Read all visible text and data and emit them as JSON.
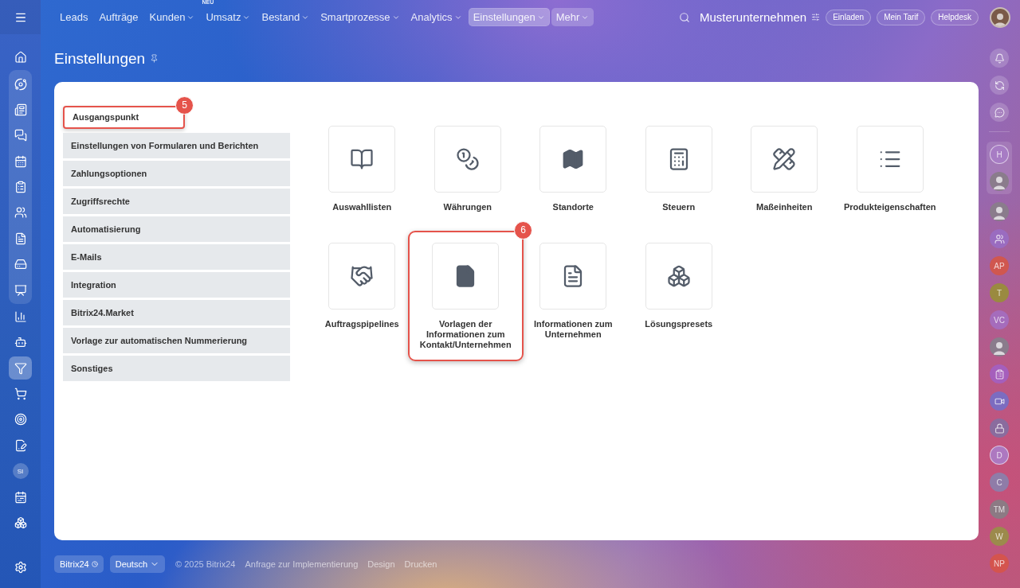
{
  "nav": {
    "items": [
      {
        "label": "Leads",
        "dropdown": false,
        "selected": false,
        "kind": "link"
      },
      {
        "label": "Aufträge",
        "dropdown": false,
        "selected": false,
        "kind": "link"
      },
      {
        "label": "Kunden",
        "dropdown": true,
        "selected": false,
        "kind": "link"
      },
      {
        "label": "Umsatz",
        "dropdown": true,
        "selected": false,
        "kind": "link",
        "badge": "NEU"
      },
      {
        "label": "Bestand",
        "dropdown": true,
        "selected": false,
        "kind": "link"
      },
      {
        "label": "Smartprozesse",
        "dropdown": true,
        "selected": false,
        "kind": "link"
      },
      {
        "label": "Analytics",
        "dropdown": true,
        "selected": false,
        "kind": "link"
      },
      {
        "label": "Einstellungen",
        "dropdown": true,
        "selected": true,
        "kind": "link"
      },
      {
        "label": "Mehr",
        "dropdown": true,
        "selected": false,
        "kind": "more"
      }
    ]
  },
  "header": {
    "company": "Musterunternehmen",
    "buttons": [
      "Einladen",
      "Mein Tarif",
      "Helpdesk"
    ]
  },
  "left_bar": {
    "top": [
      {
        "kind": "home",
        "selected": false
      }
    ],
    "group": [
      {
        "kind": "activity",
        "selected": false
      },
      {
        "kind": "news",
        "selected": false
      },
      {
        "kind": "chat",
        "selected": false
      },
      {
        "kind": "calendar",
        "selected": false
      },
      {
        "kind": "tasks",
        "selected": false
      },
      {
        "kind": "contacts",
        "selected": false
      },
      {
        "kind": "document",
        "selected": false
      },
      {
        "kind": "drive",
        "selected": false
      },
      {
        "kind": "presentation",
        "selected": false
      }
    ],
    "rest": [
      {
        "kind": "chart",
        "selected": false
      },
      {
        "kind": "bot",
        "selected": false
      },
      {
        "kind": "funnel",
        "selected": true
      },
      {
        "kind": "cart",
        "selected": false
      },
      {
        "kind": "target",
        "selected": false
      },
      {
        "kind": "sign",
        "selected": false
      },
      {
        "kind": "initials",
        "label": "SI",
        "selected": false
      },
      {
        "kind": "schedule",
        "selected": false
      },
      {
        "kind": "widget",
        "selected": false
      }
    ]
  },
  "page_title": "Einstellungen",
  "settings_menu": [
    {
      "label": "Ausgangspunkt",
      "selected": true,
      "step": "5"
    },
    {
      "label": "Einstellungen von Formularen und Berichten",
      "selected": false
    },
    {
      "label": "Zahlungsoptionen",
      "selected": false
    },
    {
      "label": "Zugriffsrechte",
      "selected": false
    },
    {
      "label": "Automatisierung",
      "selected": false
    },
    {
      "label": "E-Mails",
      "selected": false
    },
    {
      "label": "Integration",
      "selected": false
    },
    {
      "label": "Bitrix24.Market",
      "selected": false
    },
    {
      "label": "Vorlage zur automatischen Nummerierung",
      "selected": false
    },
    {
      "label": "Sonstiges",
      "selected": false
    }
  ],
  "tiles": [
    {
      "label": "Auswahllisten",
      "kind": "book"
    },
    {
      "label": "Währungen",
      "kind": "coins"
    },
    {
      "label": "Standorte",
      "kind": "map"
    },
    {
      "label": "Steuern",
      "kind": "calculator"
    },
    {
      "label": "Maßeinheiten",
      "kind": "ruler"
    },
    {
      "label": "Produkteigenschaften",
      "kind": "list"
    },
    {
      "label": "Auftragspipelines",
      "kind": "handshake"
    },
    {
      "label": "Vorlagen der Informationen zum Kontakt/Unternehmen",
      "kind": "file",
      "step": "6"
    },
    {
      "label": "Informationen zum Unternehmen",
      "kind": "document"
    },
    {
      "label": "Lösungspresets",
      "kind": "boxes"
    }
  ],
  "footer": {
    "brand": "Bitrix24",
    "language": "Deutsch",
    "copyright": "© 2025 Bitrix24",
    "links": [
      "Anfrage zur Implementierung",
      "Design",
      "Drucken"
    ]
  },
  "right_bar": {
    "top": [
      {
        "kind": "bell"
      },
      {
        "kind": "sync"
      },
      {
        "kind": "chat"
      }
    ],
    "pinned": [
      {
        "kind": "initials",
        "label": "H",
        "color": "#a77cc4",
        "ring": true
      },
      {
        "kind": "photo"
      }
    ],
    "contacts": [
      {
        "kind": "photo"
      },
      {
        "kind": "group",
        "color": "#9a6cc0"
      },
      {
        "kind": "initials",
        "label": "AP",
        "color": "#d0574f",
        "ring": false
      },
      {
        "kind": "initials",
        "label": "T",
        "color": "#9a8a40",
        "ring": false
      },
      {
        "kind": "initials",
        "label": "VC",
        "color": "#a56cbc",
        "ring": false
      },
      {
        "kind": "photo"
      },
      {
        "kind": "tasks",
        "color": "#a55fbc"
      },
      {
        "kind": "video",
        "color": "#7c6cc0"
      },
      {
        "kind": "lock",
        "color": "#8a6c9e"
      },
      {
        "kind": "initials",
        "label": "D",
        "color": "#ad78c0",
        "ring": true
      },
      {
        "kind": "initials",
        "label": "C",
        "color": "#8f7ca8"
      },
      {
        "kind": "initials",
        "label": "TM",
        "color": "#8c7a84"
      },
      {
        "kind": "initials",
        "label": "W",
        "color": "#9c8a4c"
      },
      {
        "kind": "initials",
        "label": "NP",
        "color": "#d4544e"
      }
    ]
  }
}
